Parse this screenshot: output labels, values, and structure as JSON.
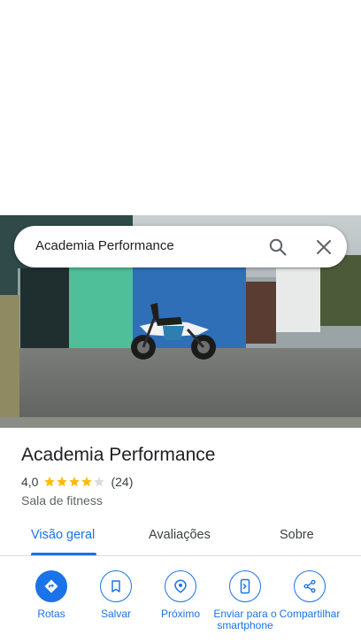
{
  "search": {
    "query": "Academia Performance"
  },
  "place": {
    "name": "Academia Performance",
    "rating": "4,0",
    "stars_filled": 4,
    "stars_total": 5,
    "reviews": "(24)",
    "category": "Sala de fitness"
  },
  "tabs": [
    {
      "label": "Visão geral",
      "active": true
    },
    {
      "label": "Avaliações",
      "active": false
    },
    {
      "label": "Sobre",
      "active": false
    }
  ],
  "actions": [
    {
      "label": "Rotas",
      "icon": "directions-icon"
    },
    {
      "label": "Salvar",
      "icon": "bookmark-icon"
    },
    {
      "label": "Próximo",
      "icon": "nearby-icon"
    },
    {
      "label": "Enviar para o smartphone",
      "icon": "send-to-phone-icon"
    },
    {
      "label": "Compartilhar",
      "icon": "share-icon"
    }
  ],
  "colors": {
    "accent": "#1a73e8",
    "star": "#fbbc04",
    "star_empty": "#dadce0"
  }
}
